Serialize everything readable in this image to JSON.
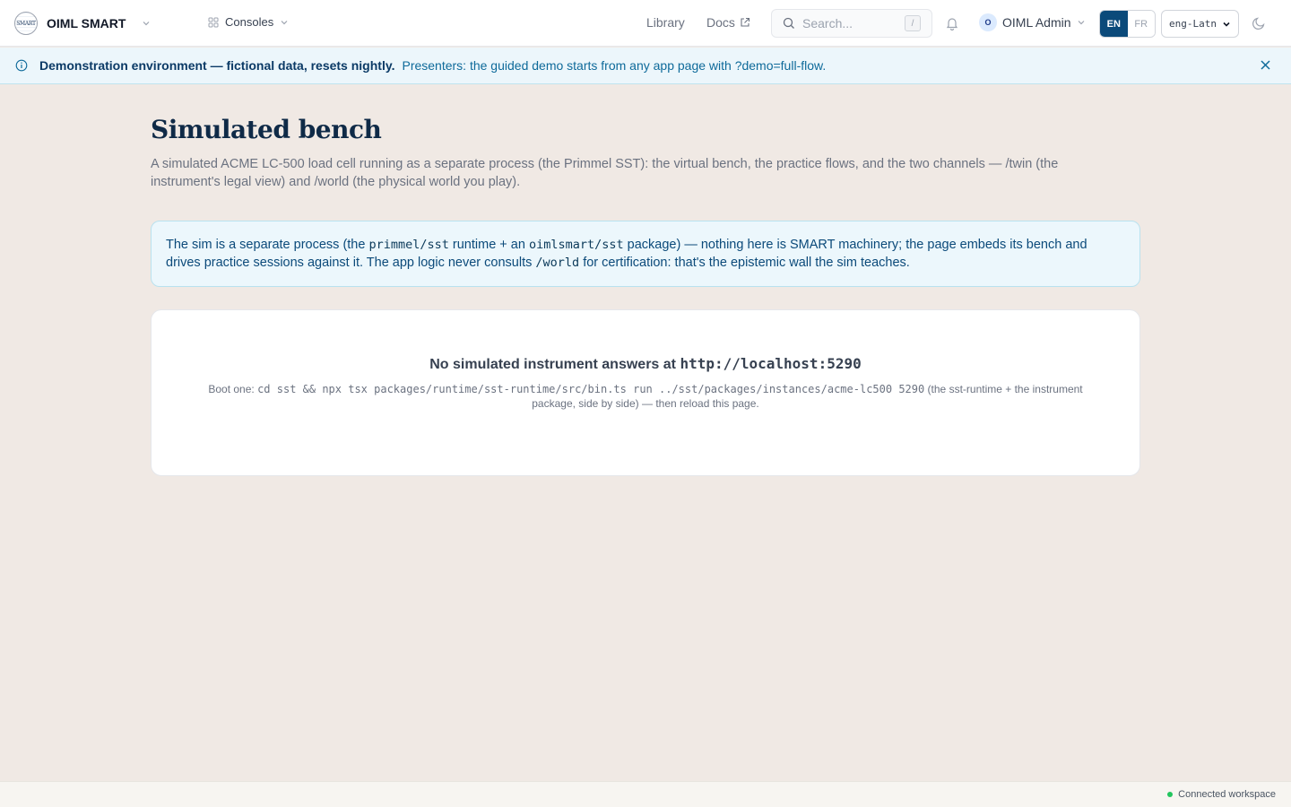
{
  "header": {
    "brand_name": "OIML SMART",
    "logo_text": "SMART",
    "consoles_label": "Consoles",
    "library_label": "Library",
    "docs_label": "Docs",
    "search_placeholder": "Search...",
    "search_shortcut": "/",
    "user_initial": "O",
    "user_name": "OIML Admin",
    "lang_en": "EN",
    "lang_fr": "FR",
    "script_value": "eng-Latn"
  },
  "banner": {
    "bold_text": "Demonstration environment — fictional data, resets nightly.",
    "text": "Presenters: the guided demo starts from any app page with ?demo=full-flow."
  },
  "page": {
    "title": "Simulated bench",
    "subtitle": "A simulated ACME LC-500 load cell running as a separate process (the Primmel SST): the virtual bench, the practice flows, and the two channels — /twin (the instrument's legal view) and /world (the physical world you play)."
  },
  "info": {
    "part1": "The sim is a separate process (the ",
    "code1": "primmel/sst",
    "part2": " runtime + an ",
    "code2": "oimlsmart/sst",
    "part3": " package) — nothing here is SMART machinery; the page embeds its bench and drives practice sessions against it. The app logic never consults ",
    "code3": "/world",
    "part4": " for certification: that's the epistemic wall the sim teaches."
  },
  "status": {
    "title_prefix": "No simulated instrument answers at ",
    "url": "http://localhost:5290",
    "help_prefix": "Boot one: ",
    "command": "cd sst && npx tsx packages/runtime/sst-runtime/src/bin.ts run ../sst/packages/instances/acme-lc500 5290",
    "help_suffix": " (the sst-runtime + the instrument package, side by side) — then reload this page."
  },
  "footer": {
    "status": "Connected workspace",
    "status_color": "#22c55e"
  }
}
